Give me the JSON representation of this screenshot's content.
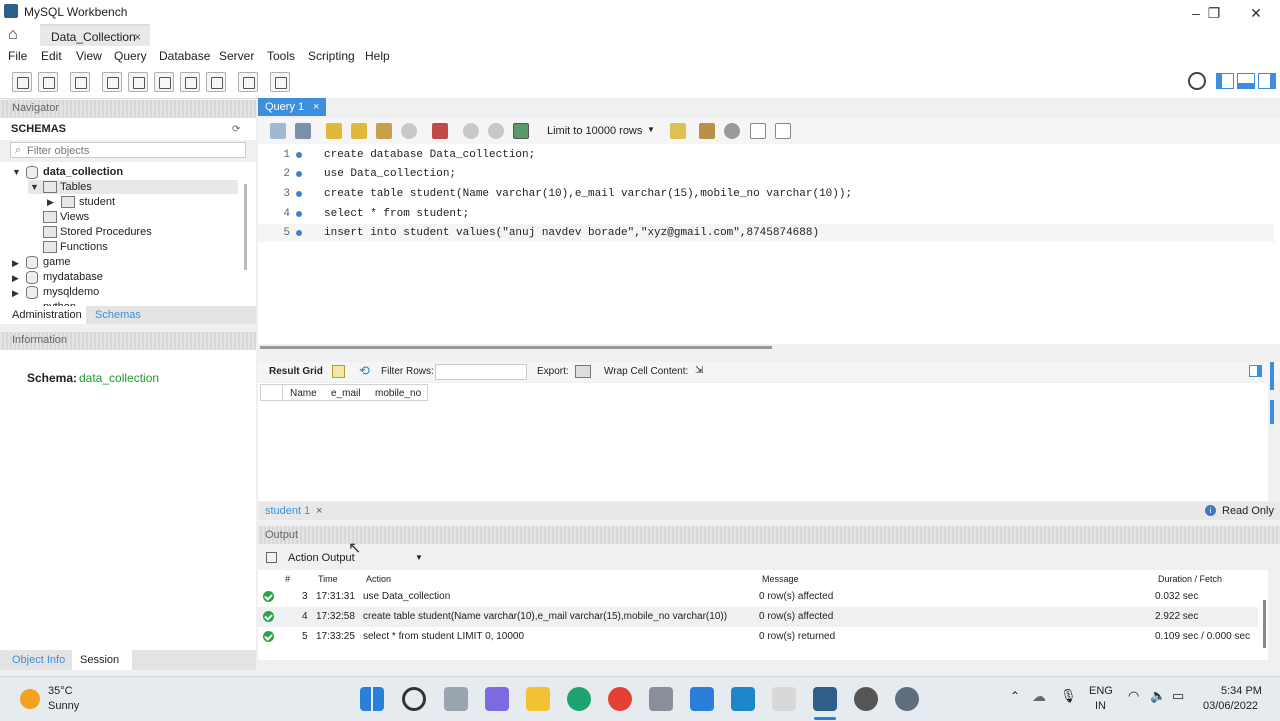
{
  "window": {
    "title": "MySQL Workbench"
  },
  "connection_tab": {
    "label": "Data_Collection"
  },
  "menu": [
    "File",
    "Edit",
    "View",
    "Query",
    "Database",
    "Server",
    "Tools",
    "Scripting",
    "Help"
  ],
  "navigator": {
    "header": "Navigator",
    "schemas_label": "SCHEMAS",
    "filter_placeholder": "Filter objects",
    "tree": {
      "db_expanded": "data_collection",
      "tables_label": "Tables",
      "table_student": "student",
      "views_label": "Views",
      "procs_label": "Stored Procedures",
      "funcs_label": "Functions",
      "db_game": "game",
      "db_mydatabase": "mydatabase",
      "db_mysqldemo": "mysqldemo",
      "db_partial": "python"
    },
    "tabs": {
      "administration": "Administration",
      "schemas": "Schemas"
    }
  },
  "information": {
    "header": "Information",
    "schema_label": "Schema:",
    "schema_value": "data_collection"
  },
  "bottom_tabs": {
    "object_info": "Object Info",
    "session": "Session"
  },
  "query_tab": {
    "label": "Query 1"
  },
  "query_toolbar": {
    "limit_label": "Limit to 10000 rows"
  },
  "editor": {
    "lines": [
      {
        "n": "1",
        "text": "create database Data_collection;"
      },
      {
        "n": "2",
        "text": "use Data_collection;"
      },
      {
        "n": "3",
        "text": "create table student(Name varchar(10),e_mail varchar(15),mobile_no varchar(10));"
      },
      {
        "n": "4",
        "text": "select * from student;"
      },
      {
        "n": "5",
        "text": "insert into student values(\"anuj navdev borade\",\"xyz@gmail.com\",8745874688)"
      }
    ]
  },
  "result_bar": {
    "result_grid": "Result Grid",
    "filter_rows": "Filter Rows:",
    "export": "Export:",
    "wrap": "Wrap Cell Content:"
  },
  "result_columns": [
    "Name",
    "e_mail",
    "mobile_no"
  ],
  "result_tab": {
    "label": "student 1",
    "read_only": "Read Only"
  },
  "output": {
    "header": "Output",
    "selector": "Action Output",
    "columns": {
      "num": "#",
      "time": "Time",
      "action": "Action",
      "message": "Message",
      "duration": "Duration / Fetch"
    },
    "rows": [
      {
        "num": "3",
        "time": "17:31:31",
        "action": "use Data_collection",
        "message": "0 row(s) affected",
        "duration": "0.032 sec"
      },
      {
        "num": "4",
        "time": "17:32:58",
        "action": "create table student(Name varchar(10),e_mail varchar(15),mobile_no varchar(10))",
        "message": "0 row(s) affected",
        "duration": "2.922 sec"
      },
      {
        "num": "5",
        "time": "17:33:25",
        "action": "select * from student LIMIT 0, 10000",
        "message": "0 row(s) returned",
        "duration": "0.109 sec / 0.000 sec"
      }
    ]
  },
  "taskbar": {
    "weather_temp": "35°C",
    "weather_desc": "Sunny",
    "lang1": "ENG",
    "lang2": "IN",
    "time": "5:34 PM",
    "date": "03/06/2022"
  },
  "colors": {
    "accent": "#3c8fdc",
    "schema_green": "#1e9b2e",
    "success": "#2ba248"
  }
}
